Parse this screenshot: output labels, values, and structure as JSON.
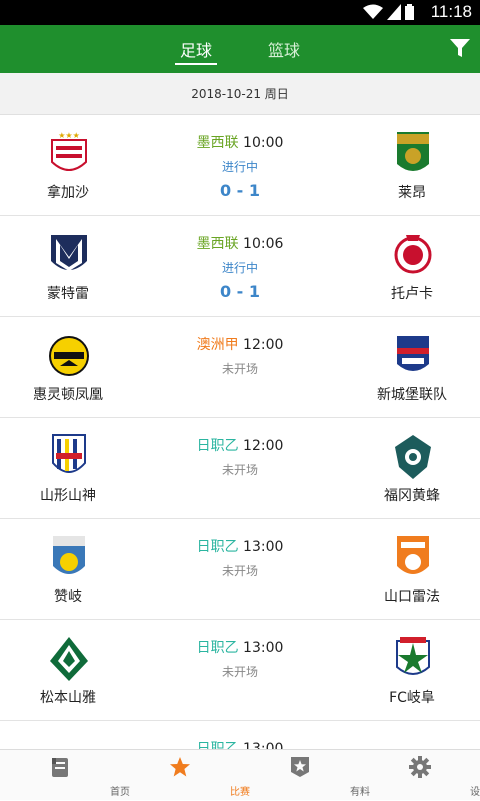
{
  "status_bar": {
    "time": "11:18"
  },
  "header": {
    "tabs": [
      {
        "label": "足球",
        "active": true
      },
      {
        "label": "篮球",
        "active": false
      }
    ],
    "filter_icon": "filter-icon"
  },
  "date_bar": {
    "date": "2018-10-21 周日"
  },
  "matches": [
    {
      "home": "拿加沙",
      "away": "莱昂",
      "league": "墨西联",
      "league_color": "#6aa524",
      "time": "10:00",
      "status": "进行中",
      "status_color": "#3d86c9",
      "score": "0 - 1",
      "home_logo": "necaxa-crest-icon",
      "away_logo": "leon-crest-icon"
    },
    {
      "home": "蒙特雷",
      "away": "托卢卡",
      "league": "墨西联",
      "league_color": "#6aa524",
      "time": "10:06",
      "status": "进行中",
      "status_color": "#3d86c9",
      "score": "0 - 1",
      "home_logo": "monterrey-crest-icon",
      "away_logo": "toluca-crest-icon"
    },
    {
      "home": "惠灵顿凤凰",
      "away": "新城堡联队",
      "league": "澳洲甲",
      "league_color": "#f07c1e",
      "time": "12:00",
      "status": "未开场",
      "status_color": "#888888",
      "score": "",
      "home_logo": "wellington-phoenix-crest-icon",
      "away_logo": "newcastle-jets-crest-icon"
    },
    {
      "home": "山形山神",
      "away": "福冈黄蜂",
      "league": "日职乙",
      "league_color": "#2bb5a0",
      "time": "12:00",
      "status": "未开场",
      "status_color": "#888888",
      "score": "",
      "home_logo": "montedio-crest-icon",
      "away_logo": "avispa-crest-icon"
    },
    {
      "home": "赞岐",
      "away": "山口雷法",
      "league": "日职乙",
      "league_color": "#2bb5a0",
      "time": "13:00",
      "status": "未开场",
      "status_color": "#888888",
      "score": "",
      "home_logo": "kamatamare-crest-icon",
      "away_logo": "renofa-crest-icon"
    },
    {
      "home": "松本山雅",
      "away": "FC岐阜",
      "league": "日职乙",
      "league_color": "#2bb5a0",
      "time": "13:00",
      "status": "未开场",
      "status_color": "#888888",
      "score": "",
      "home_logo": "matsumoto-crest-icon",
      "away_logo": "gifu-crest-icon"
    },
    {
      "home": "",
      "away": "",
      "league": "日职乙",
      "league_color": "#2bb5a0",
      "time": "13:00",
      "status": "",
      "status_color": "#888888",
      "score": "",
      "home_logo": "partial-crest-icon",
      "away_logo": "partial-crest-icon"
    }
  ],
  "bottom_nav": [
    {
      "label": "首页",
      "icon": "home-icon",
      "active": false
    },
    {
      "label": "比赛",
      "icon": "star-icon",
      "active": true
    },
    {
      "label": "有料",
      "icon": "badge-star-icon",
      "active": false
    },
    {
      "label": "设置",
      "icon": "gear-icon",
      "active": false
    }
  ],
  "colors": {
    "header_green": "#1f8f2d",
    "active_nav": "#f07c1e",
    "score_blue": "#3d86c9"
  }
}
